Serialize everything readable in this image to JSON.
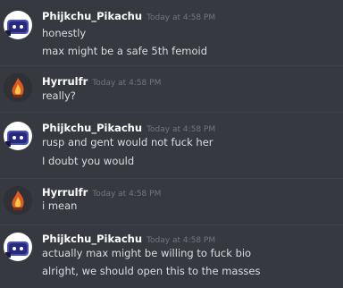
{
  "messages": [
    {
      "username": "Phijkchu_Pikachu",
      "timestamp": "Today at 4:58 PM",
      "avatar_icon": "pikachu-avatar-icon",
      "lines": [
        "honestly",
        "max might be a safe 5th femoid"
      ]
    },
    {
      "username": "Hyrrulfr",
      "timestamp": "Today at 4:58 PM",
      "avatar_icon": "flame-avatar-icon",
      "lines": [
        "really?"
      ]
    },
    {
      "username": "Phijkchu_Pikachu",
      "timestamp": "Today at 4:58 PM",
      "avatar_icon": "pikachu-avatar-icon",
      "lines": [
        "rusp and gent would not fuck her",
        "I doubt you would"
      ]
    },
    {
      "username": "Hyrrulfr",
      "timestamp": "Today at 4:58 PM",
      "avatar_icon": "flame-avatar-icon",
      "lines": [
        "i mean"
      ]
    },
    {
      "username": "Phijkchu_Pikachu",
      "timestamp": "Today at 4:58 PM",
      "avatar_icon": "pikachu-avatar-icon",
      "lines": [
        "actually max might be willing to fuck bio",
        "alright, we should open this to the masses"
      ]
    }
  ],
  "colors": {
    "background": "#36393f",
    "username": "#ffffff",
    "timestamp": "#72767d",
    "message_text": "#dcddde"
  }
}
